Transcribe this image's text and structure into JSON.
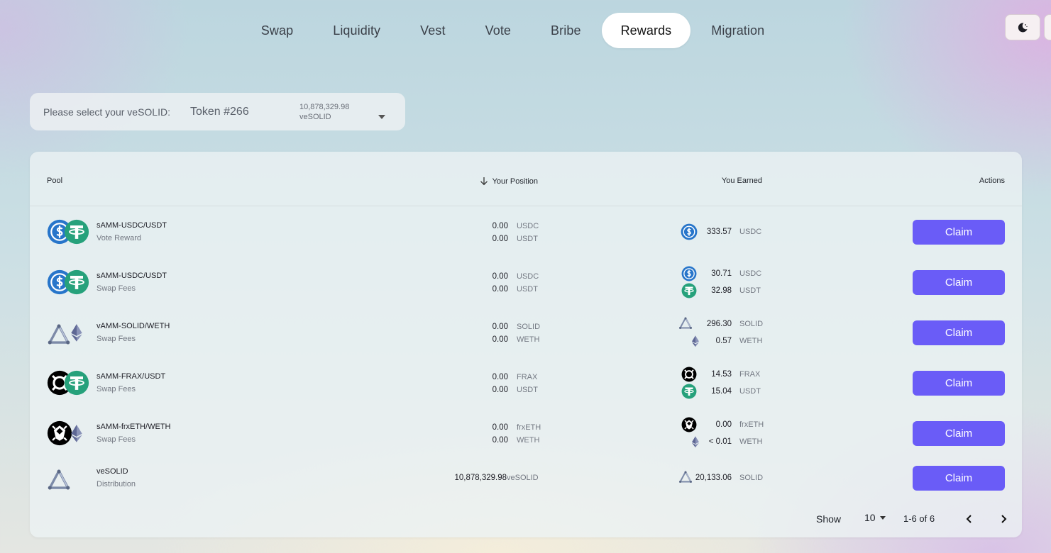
{
  "nav": {
    "tabs": [
      {
        "label": "Swap"
      },
      {
        "label": "Liquidity"
      },
      {
        "label": "Vest"
      },
      {
        "label": "Vote"
      },
      {
        "label": "Bribe"
      },
      {
        "label": "Rewards",
        "active": true
      },
      {
        "label": "Migration"
      }
    ]
  },
  "theme_toggle": {
    "icon": "moon-icon"
  },
  "selector": {
    "label": "Please select your veSOLID:",
    "token": "Token #266",
    "balance": "10,878,329.98",
    "balance_unit": "veSOLID"
  },
  "table": {
    "headers": {
      "pool": "Pool",
      "position": "Your Position",
      "earned": "You Earned",
      "actions": "Actions"
    },
    "rows": [
      {
        "pool": "sAMM-USDC/USDT",
        "type": "Vote Reward",
        "icons": [
          "usdc-icon",
          "usdt-icon"
        ],
        "position": [
          {
            "amount": "0.00",
            "symbol": "USDC"
          },
          {
            "amount": "0.00",
            "symbol": "USDT"
          }
        ],
        "earned": [
          {
            "icon": "usdc-icon",
            "amount": "333.57",
            "symbol": "USDC"
          }
        ],
        "action": "Claim"
      },
      {
        "pool": "sAMM-USDC/USDT",
        "type": "Swap Fees",
        "icons": [
          "usdc-icon",
          "usdt-icon"
        ],
        "position": [
          {
            "amount": "0.00",
            "symbol": "USDC"
          },
          {
            "amount": "0.00",
            "symbol": "USDT"
          }
        ],
        "earned": [
          {
            "icon": "usdc-icon",
            "amount": "30.71",
            "symbol": "USDC"
          },
          {
            "icon": "usdt-icon",
            "amount": "32.98",
            "symbol": "USDT"
          }
        ],
        "action": "Claim"
      },
      {
        "pool": "vAMM-SOLID/WETH",
        "type": "Swap Fees",
        "icons": [
          "solid-icon",
          "weth-icon"
        ],
        "position": [
          {
            "amount": "0.00",
            "symbol": "SOLID"
          },
          {
            "amount": "0.00",
            "symbol": "WETH"
          }
        ],
        "earned": [
          {
            "icon": "solid-icon",
            "amount": "296.30",
            "symbol": "SOLID"
          },
          {
            "icon": "weth-icon",
            "amount": "0.57",
            "symbol": "WETH"
          }
        ],
        "action": "Claim"
      },
      {
        "pool": "sAMM-FRAX/USDT",
        "type": "Swap Fees",
        "icons": [
          "frax-icon",
          "usdt-icon"
        ],
        "position": [
          {
            "amount": "0.00",
            "symbol": "FRAX"
          },
          {
            "amount": "0.00",
            "symbol": "USDT"
          }
        ],
        "earned": [
          {
            "icon": "frax-icon",
            "amount": "14.53",
            "symbol": "FRAX"
          },
          {
            "icon": "usdt-icon",
            "amount": "15.04",
            "symbol": "USDT"
          }
        ],
        "action": "Claim"
      },
      {
        "pool": "sAMM-frxETH/WETH",
        "type": "Swap Fees",
        "icons": [
          "frxeth-icon",
          "weth-icon"
        ],
        "position": [
          {
            "amount": "0.00",
            "symbol": "frxETH"
          },
          {
            "amount": "0.00",
            "symbol": "WETH"
          }
        ],
        "earned": [
          {
            "icon": "frxeth-icon",
            "amount": "0.00",
            "symbol": "frxETH"
          },
          {
            "icon": "weth-icon",
            "amount": "< 0.01",
            "symbol": "WETH"
          }
        ],
        "action": "Claim"
      },
      {
        "pool": "veSOLID",
        "type": "Distribution",
        "icons": [
          "solid-icon"
        ],
        "position": [
          {
            "amount": "10,878,329.98",
            "symbol": "veSOLID"
          }
        ],
        "earned": [
          {
            "icon": "solid-icon",
            "amount": "20,133.06",
            "symbol": "SOLID"
          }
        ],
        "action": "Claim"
      }
    ]
  },
  "pagination": {
    "show_label": "Show",
    "page_size": "10",
    "range": "1-6 of 6"
  },
  "colors": {
    "accent": "#6a5cf7",
    "usdc": "#2775ca",
    "usdt": "#26a17b"
  }
}
